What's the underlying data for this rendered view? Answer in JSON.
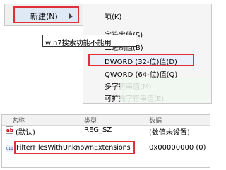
{
  "context_menu": {
    "new_label": "新建(N)",
    "submenu": {
      "items": [
        {
          "label": "项(K)"
        },
        {
          "label": "字符串值(S)"
        },
        {
          "label": "二进制值(B)"
        },
        {
          "label": "DWORD (32-位)值(D)"
        },
        {
          "label": "QWORD (64-位)值(Q)"
        },
        {
          "label": "多字符串值(M)"
        },
        {
          "label": "可扩充字符串值(E)"
        }
      ]
    }
  },
  "tooltip": {
    "text": "win7搜索功能不能用"
  },
  "registry": {
    "headers": {
      "name": "名称",
      "type": "类型",
      "data": "数据"
    },
    "rows": [
      {
        "icon": "ab",
        "name": "(默认)",
        "type": "REG_SZ",
        "data": "(数值未设置)"
      },
      {
        "icon": "binary",
        "name": "FilterFilesWithUnknownExtensions",
        "type": "",
        "data": "0x00000000 (0)"
      }
    ]
  },
  "colors": {
    "highlight_border": "#e0303a",
    "selection_bg": "#dfe9f6",
    "menu_bg": "#f5f5f5"
  }
}
